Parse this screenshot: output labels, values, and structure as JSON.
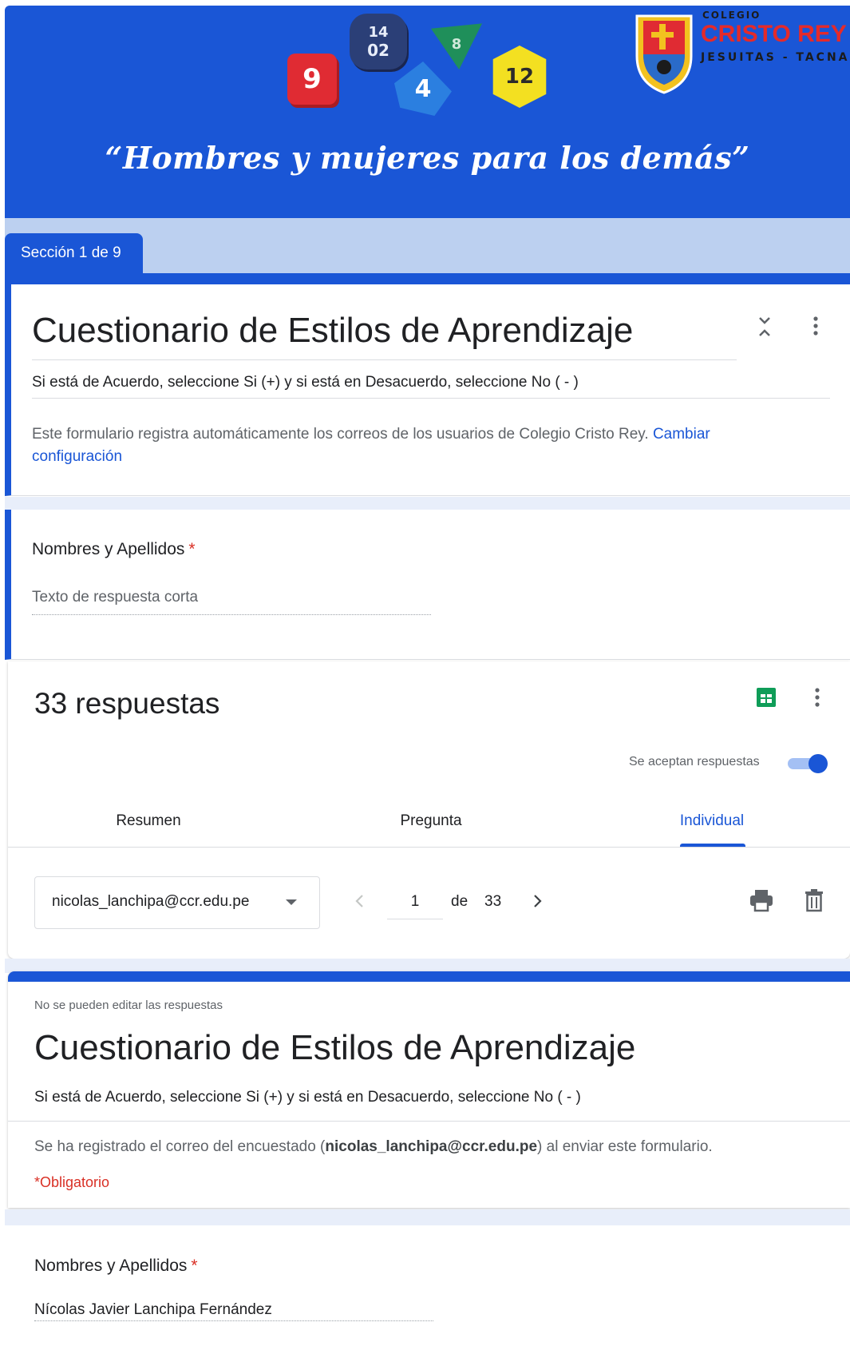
{
  "header": {
    "motto": "“Hombres y mujeres para los demás”",
    "school_top": "COLEGIO",
    "school_name": "CRISTO REY",
    "school_bottom": "JESUITAS - TACNA",
    "dice": [
      "9",
      "14",
      "02",
      "4",
      "8",
      "12"
    ],
    "brand_color": "#1a56d6"
  },
  "section": {
    "label": "Sección 1 de 9"
  },
  "form": {
    "title": "Cuestionario de Estilos de Aprendizaje",
    "description": "Si está de Acuerdo, seleccione Si (+) y si está en Desacuerdo, seleccione No ( - )",
    "email_notice": "Este formulario registra automáticamente los correos de los usuarios de Colegio Cristo Rey.",
    "change_settings_link": "Cambiar configuración",
    "icons": [
      "collapse-icon",
      "more-vert-icon"
    ]
  },
  "question1": {
    "label": "Nombres y Apellidos",
    "required_marker": "*",
    "placeholder": "Texto de respuesta corta"
  },
  "responses": {
    "count_label": "33 respuestas",
    "accepting_label": "Se aceptan respuestas",
    "accepting": true,
    "tabs": [
      {
        "label": "Resumen",
        "active": false
      },
      {
        "label": "Pregunta",
        "active": false
      },
      {
        "label": "Individual",
        "active": true
      }
    ],
    "selected_respondent": "nicolas_lanchipa@ccr.edu.pe",
    "page_current": "1",
    "page_of": "de",
    "page_total": "33",
    "icons": [
      "sheets-icon",
      "more-vert-icon",
      "chevron-left-icon",
      "chevron-right-icon",
      "print-icon",
      "delete-icon"
    ]
  },
  "individual": {
    "no_edit_note": "No se pueden editar las respuestas",
    "title": "Cuestionario de Estilos de Aprendizaje",
    "description": "Si está de Acuerdo, seleccione Si (+) y si está en Desacuerdo, seleccione No ( - )",
    "recorded_prefix": "Se ha registrado el correo del encuestado (",
    "recorded_email": "nicolas_lanchipa@ccr.edu.pe",
    "recorded_suffix": ") al enviar este formulario.",
    "required_note": "*Obligatorio",
    "question_label": "Nombres y Apellidos",
    "required_marker": "*",
    "answer": "Nícolas Javier Lanchipa Fernández"
  }
}
